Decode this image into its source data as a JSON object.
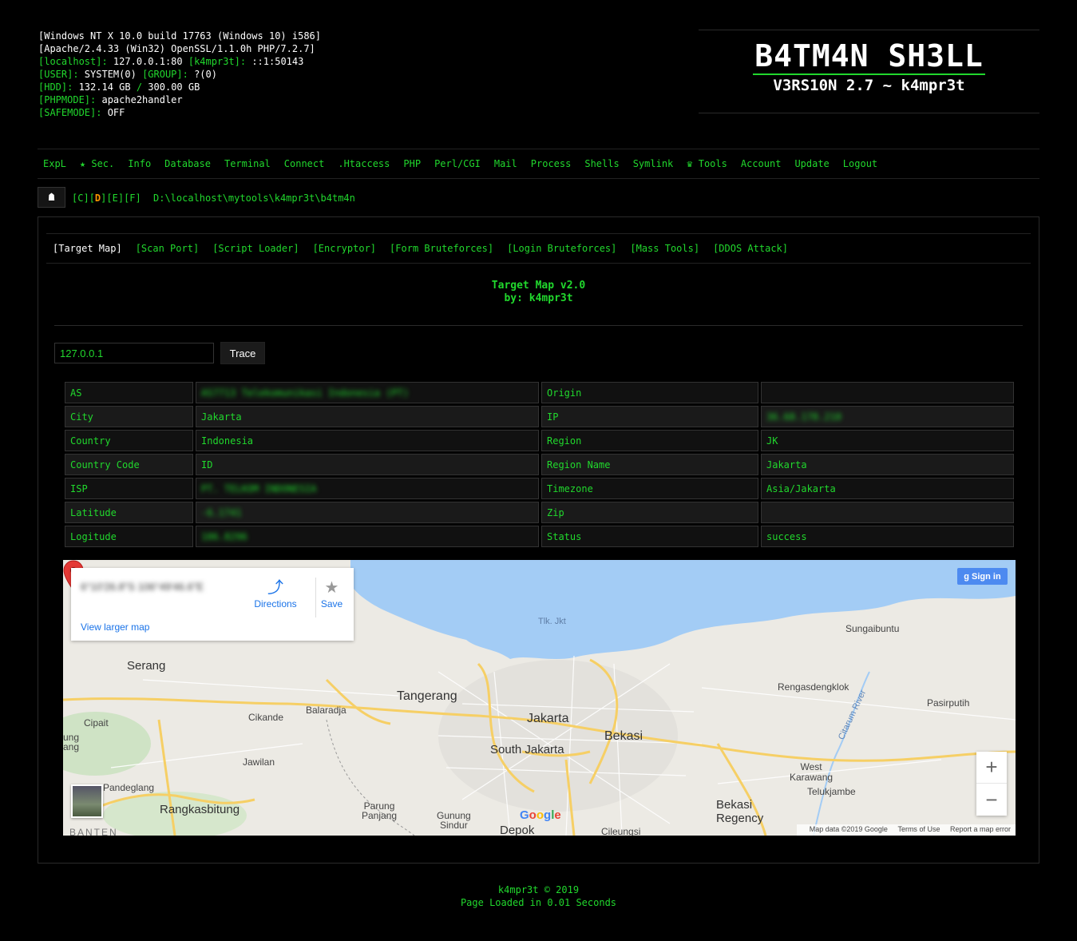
{
  "sysinfo": {
    "line1": "[Windows NT X 10.0 build 17763 (Windows 10) i586]",
    "line2": "[Apache/2.4.33 (Win32) OpenSSL/1.1.0h PHP/7.2.7]",
    "localhost_label": "[localhost]:",
    "localhost_value": " 127.0.0.1:80 ",
    "k4_label": "[k4mpr3t]:",
    "k4_value": " ::1:50143",
    "user_label": "[USER]:",
    "user_value": " SYSTEM(0) ",
    "group_label": "[GROUP]:",
    "group_value": " ?(0)",
    "hdd_label": "[HDD]:",
    "hdd_value": " 132.14 GB ",
    "hdd_sep": "/",
    "hdd_total": " 300.00 GB",
    "phpmode_label": "[PHPMODE]:",
    "phpmode_value": " apache2handler",
    "safemode_label": "[SAFEMODE]:",
    "safemode_value": " OFF"
  },
  "banner": {
    "title": "B4TM4N SH3LL",
    "subtitle": "V3RS10N 2.7 ~ k4mpr3t"
  },
  "menu": [
    "ExpL",
    "★ Sec.",
    "Info",
    "Database",
    "Terminal",
    "Connect",
    ".Htaccess",
    "PHP",
    "Perl/CGI",
    "Mail",
    "Process",
    "Shells",
    "Symlink",
    "♛ Tools",
    "Account",
    "Update",
    "Logout"
  ],
  "path": {
    "home_icon": "home-icon",
    "drives": [
      "C",
      "D",
      "E",
      "F"
    ],
    "active_drive": "D",
    "current": "D:\\localhost\\mytools\\k4mpr3t\\b4tm4n"
  },
  "tabs": [
    "[Target Map]",
    "[Scan Port]",
    "[Script Loader]",
    "[Encryptor]",
    "[Form Bruteforces]",
    "[Login Bruteforces]",
    "[Mass Tools]",
    "[DDOS Attack]"
  ],
  "tool": {
    "title": "Target Map v2.0",
    "author": "by: k4mpr3t"
  },
  "trace": {
    "ip_value": "127.0.0.1",
    "button": "Trace"
  },
  "info_rows": [
    {
      "k1": "AS",
      "v1": "AS7713 Telekomunikasi Indonesia (PT)",
      "v1_blur": true,
      "k2": "Origin",
      "v2": "",
      "v2_blur": false
    },
    {
      "k1": "City",
      "v1": "Jakarta",
      "v1_blur": false,
      "k2": "IP",
      "v2": "36.68.178.210",
      "v2_blur": true
    },
    {
      "k1": "Country",
      "v1": "Indonesia",
      "v1_blur": false,
      "k2": "Region",
      "v2": "JK",
      "v2_blur": false
    },
    {
      "k1": "Country Code",
      "v1": "ID",
      "v1_blur": false,
      "k2": "Region Name",
      "v2": "Jakarta",
      "v2_blur": false
    },
    {
      "k1": "ISP",
      "v1": "PT. TELKOM INDONESIA",
      "v1_blur": true,
      "k2": "Timezone",
      "v2": "Asia/Jakarta",
      "v2_blur": false
    },
    {
      "k1": "Latitude",
      "v1": "-6.1741",
      "v1_blur": true,
      "k2": "Zip",
      "v2": "",
      "v2_blur": false
    },
    {
      "k1": "Logitude",
      "v1": "106.8296",
      "v1_blur": true,
      "k2": "Status",
      "v2": "success",
      "v2_blur": false
    }
  ],
  "map": {
    "card_coords": "6°10'26.8\"S 106°49'46.6\"E",
    "directions": "Directions",
    "save": "Save",
    "view_larger": "View larger map",
    "signin": "Sign in",
    "zoom_in": "+",
    "zoom_out": "−",
    "google": "Google",
    "attribution": {
      "data": "Map data ©2019 Google",
      "terms": "Terms of Use",
      "report": "Report a map error"
    },
    "labels": {
      "tlk_jkt": "Tlk. Jkt",
      "serang": "Serang",
      "tangerang": "Tangerang",
      "jakarta": "Jakarta",
      "bekasi": "Bekasi",
      "south_jakarta": "South Jakarta",
      "depok": "Depok",
      "cikande": "Cikande",
      "balaraja": "Balaradja",
      "cipait": "Cipait",
      "jawilan": "Jawilan",
      "pandeglang": "Pandeglang",
      "rangkasbitung": "Rangkasbitung",
      "banten": "BANTEN",
      "parung": "Parung\nPanjang",
      "gunung": "Gunung\nSindur",
      "cileungsi": "Cileungsi",
      "sungaibuntu": "Sungaibuntu",
      "rengas": "Rengasdengklok",
      "pasirputih": "Pasirputih",
      "citarum": "Citarum River",
      "west_karawang": "West\nKarawang",
      "telukjambe": "Telukjambe",
      "bekasi_regency": "Bekasi\nRegency",
      "ung": "ung\nang"
    }
  },
  "footer": {
    "copyright": "k4mpr3t © 2019",
    "loaded": "Page Loaded in 0.01 Seconds"
  },
  "colors": {
    "accent": "#21d82d",
    "active_drive": "#ff9800",
    "background": "#000000"
  }
}
